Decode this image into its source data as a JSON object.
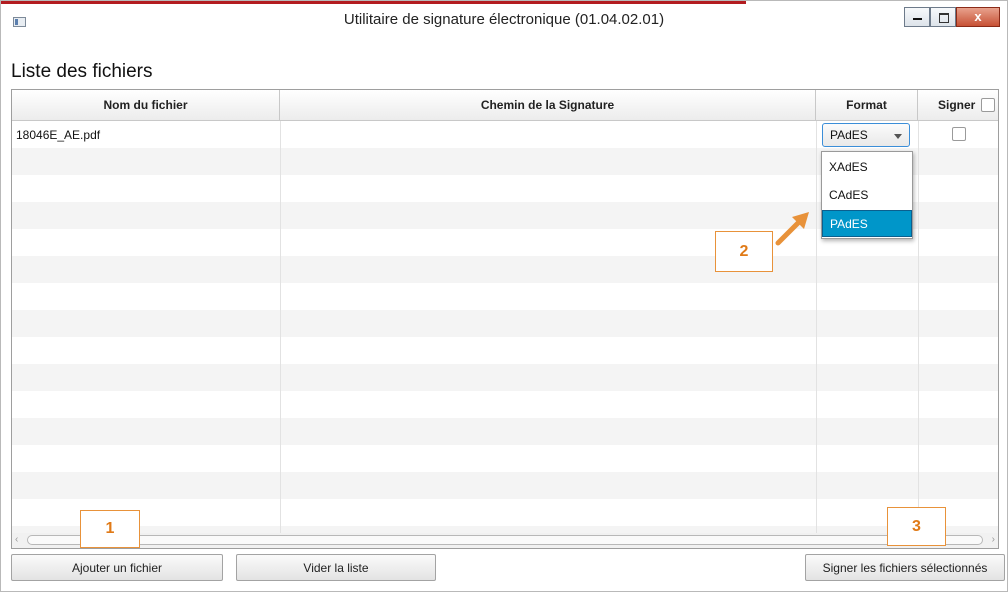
{
  "window": {
    "title": "Utilitaire de signature électronique (01.04.02.01)",
    "close_label": "x"
  },
  "page": {
    "title": "Liste des fichiers"
  },
  "table": {
    "columns": [
      "Nom du fichier",
      "Chemin de la Signature",
      "Format",
      "Signer"
    ],
    "rows": [
      {
        "file_name": "18046E_AE.pdf",
        "signature_path": "",
        "format": "PAdES",
        "sign": false
      }
    ]
  },
  "format_dropdown": {
    "options": [
      "XAdES",
      "CAdES",
      "PAdES"
    ],
    "selected": "PAdES"
  },
  "buttons": {
    "add_file": "Ajouter un fichier",
    "clear_list": "Vider la liste",
    "sign_selected": "Signer les fichiers sélectionnés"
  },
  "callouts": [
    "1",
    "2",
    "3"
  ],
  "colors": {
    "accent_red": "#b31c20",
    "callout_orange": "#e8923a",
    "selection_blue": "#0096c9",
    "focus_blue": "#3b8ed8"
  }
}
